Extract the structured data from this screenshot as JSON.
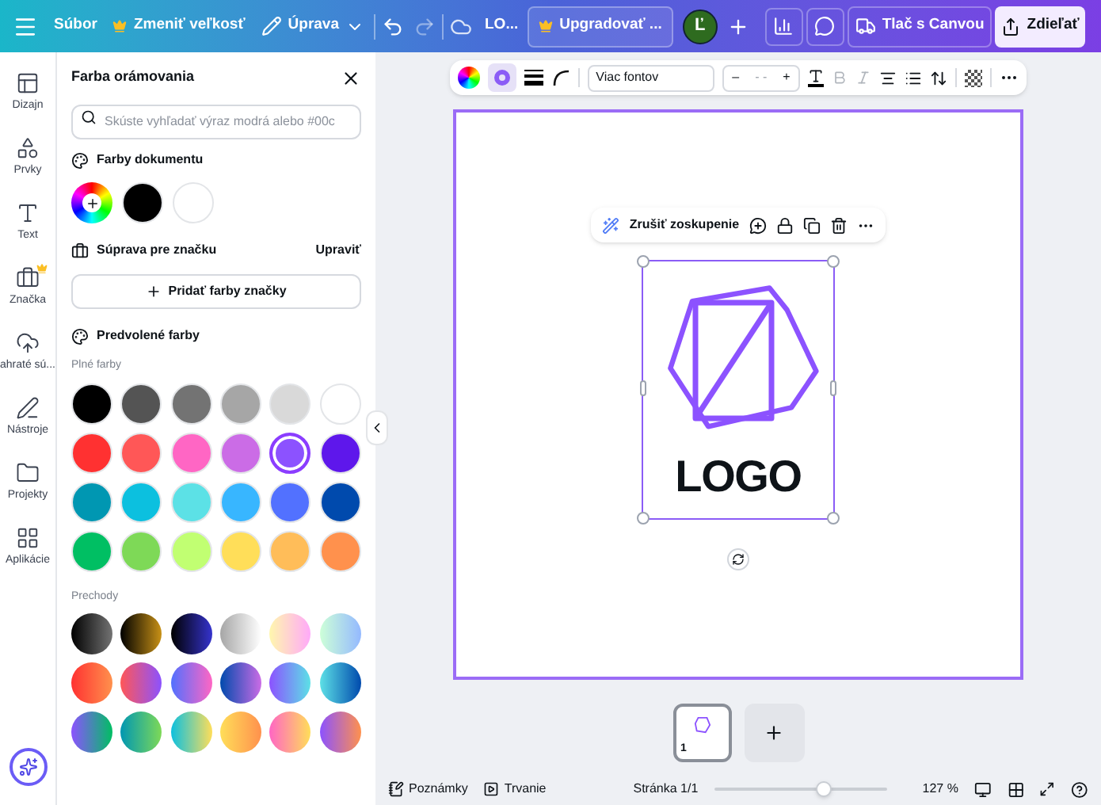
{
  "topbar": {
    "file_menu": "Súbor",
    "resize": "Zmeniť veľkosť",
    "edit": "Úprava",
    "redo_disabled": true,
    "title": "LO...",
    "upgrade": "Upgradovať ...",
    "avatar": "Ľ",
    "print": "Tlač s Canvou",
    "share": "Zdieľať"
  },
  "rail": [
    {
      "label": "Dizajn",
      "premium": false
    },
    {
      "label": "Prvky",
      "premium": false
    },
    {
      "label": "Text",
      "premium": false
    },
    {
      "label": "Značka",
      "premium": true
    },
    {
      "label": "ahraté sú...",
      "premium": false
    },
    {
      "label": "Nástroje",
      "premium": false
    },
    {
      "label": "Projekty",
      "premium": false
    },
    {
      "label": "Aplikácie",
      "premium": false
    }
  ],
  "panel": {
    "title": "Farba orámovania",
    "search_placeholder": "Skúste vyhľadať výraz modrá alebo #00c",
    "document_colors_title": "Farby dokumentu",
    "document_colors": [
      {
        "color": "#000000"
      },
      {
        "color": "#ffffff"
      }
    ],
    "brand_kit_title": "Súprava pre značku",
    "brand_kit_edit": "Upraviť",
    "add_brand_colors": "Pridať farby značky",
    "default_colors_title": "Predvolené farby",
    "solid_title": "Plné farby",
    "solid_colors": [
      {
        "color": "#000000",
        "selected": false
      },
      {
        "color": "#545454",
        "selected": false
      },
      {
        "color": "#737373",
        "selected": false
      },
      {
        "color": "#a6a6a6",
        "selected": false
      },
      {
        "color": "#d9d9d9",
        "selected": false
      },
      {
        "color": "#ffffff",
        "selected": false
      },
      {
        "color": "#ff3131",
        "selected": false
      },
      {
        "color": "#ff5757",
        "selected": false
      },
      {
        "color": "#ff66c4",
        "selected": false
      },
      {
        "color": "#cb6ce6",
        "selected": false
      },
      {
        "color": "#8c52ff",
        "selected": true
      },
      {
        "color": "#5e17eb",
        "selected": false
      },
      {
        "color": "#0097b2",
        "selected": false
      },
      {
        "color": "#0cc0df",
        "selected": false
      },
      {
        "color": "#5ce1e6",
        "selected": false
      },
      {
        "color": "#38b6ff",
        "selected": false
      },
      {
        "color": "#5271ff",
        "selected": false
      },
      {
        "color": "#004aad",
        "selected": false
      },
      {
        "color": "#00bf63",
        "selected": false
      },
      {
        "color": "#7ed957",
        "selected": false
      },
      {
        "color": "#c1ff72",
        "selected": false
      },
      {
        "color": "#ffde59",
        "selected": false
      },
      {
        "color": "#ffbd59",
        "selected": false
      },
      {
        "color": "#ff914d",
        "selected": false
      }
    ],
    "gradients_title": "Prechody"
  },
  "toolbar": {
    "font": "Viac fontov",
    "minus": "–",
    "size": "- -",
    "plus": "+",
    "border_style_selected": true
  },
  "canvas": {
    "floating_toolbar": {
      "ungroup": "Zrušiť zoskupenie"
    },
    "logo_text": "LOGO",
    "thumbnail_number": "1"
  },
  "statusbar": {
    "notes": "Poznámky",
    "duration": "Trvanie",
    "page": "Stránka 1/1",
    "level": 0.63,
    "zoom": "127 %"
  }
}
